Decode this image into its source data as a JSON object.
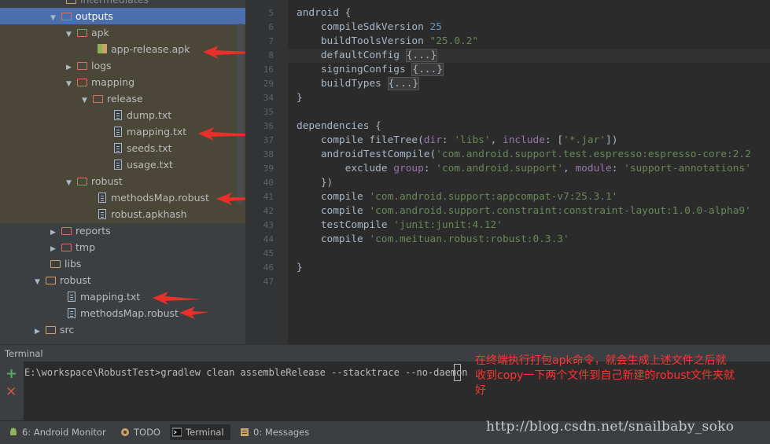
{
  "tree": {
    "items": [
      {
        "label": "intermediates",
        "indent": 3
      },
      {
        "label": "outputs"
      },
      {
        "label": "apk"
      },
      {
        "label": "app-release.apk"
      },
      {
        "label": "logs"
      },
      {
        "label": "mapping"
      },
      {
        "label": "release"
      },
      {
        "label": "dump.txt"
      },
      {
        "label": "mapping.txt"
      },
      {
        "label": "seeds.txt"
      },
      {
        "label": "usage.txt"
      },
      {
        "label": "robust"
      },
      {
        "label": "methodsMap.robust"
      },
      {
        "label": "robust.apkhash"
      },
      {
        "label": "reports"
      },
      {
        "label": "tmp"
      },
      {
        "label": "libs"
      },
      {
        "label": "robust"
      },
      {
        "label": "mapping.txt"
      },
      {
        "label": "methodsMap.robust"
      },
      {
        "label": "src"
      }
    ]
  },
  "editor": {
    "line_numbers": [
      "5",
      "6",
      "7",
      "8",
      "16",
      "29",
      "34",
      "35",
      "36",
      "37",
      "38",
      "39",
      "40",
      "41",
      "42",
      "43",
      "44",
      "45",
      "46",
      "47"
    ],
    "lines": [
      {
        "t": "android {"
      },
      {
        "t": "    compileSdkVersion ",
        "n": "25"
      },
      {
        "t": "    buildToolsVersion ",
        "s": "\"25.0.2\""
      },
      {
        "t": "    defaultConfig ",
        "b": "{...}"
      },
      {
        "t": "    signingConfigs ",
        "b": "{...}"
      },
      {
        "t": "    buildTypes ",
        "b": "{...}"
      },
      {
        "t": "}"
      },
      {
        "t": ""
      },
      {
        "t": "dependencies {"
      },
      {
        "t": "    compile fileTree(",
        "p1": "dir",
        "m1": ": ",
        "s1": "'libs'",
        "m2": ", ",
        "p2": "include",
        "m3": ": [",
        "s2": "'*.jar'",
        "m4": "])"
      },
      {
        "t": "    androidTestCompile(",
        "s": "'com.android.support.test.espresso:espresso-core:2.2"
      },
      {
        "t": "        exclude ",
        "p1": "group",
        "m1": ": ",
        "s1": "'com.android.support'",
        "m2": ", ",
        "p2": "module",
        "m3": ": ",
        "s2": "'support-annotations'"
      },
      {
        "t": "    })"
      },
      {
        "t": "    compile ",
        "s": "'com.android.support:appcompat-v7:25.3.1'"
      },
      {
        "t": "    compile ",
        "s": "'com.android.support.constraint:constraint-layout:1.0.0-alpha9'"
      },
      {
        "t": "    testCompile ",
        "s": "'junit:junit:4.12'"
      },
      {
        "t": "    compile ",
        "s": "'com.meituan.robust:robust:0.3.3'"
      },
      {
        "t": ""
      },
      {
        "t": "}"
      },
      {
        "t": ""
      }
    ]
  },
  "terminal": {
    "header": "Terminal",
    "command": "E:\\workspace\\RobustTest>gradlew clean assembleRelease --stacktrace --no-daemon",
    "annotation": "在终端执行打包apk命令，就会生成上述文件之后就收到copy一下两个文件到自己新建的robust文件夹就好"
  },
  "toolwindows": [
    {
      "label": "6: Android Monitor"
    },
    {
      "label": "TODO"
    },
    {
      "label": "Terminal"
    },
    {
      "label": "0: Messages"
    }
  ],
  "watermark": "http://blog.csdn.net/snailbaby_soko",
  "colors": {
    "annotation": "#ff3333",
    "selection": "#4b6eaf"
  }
}
